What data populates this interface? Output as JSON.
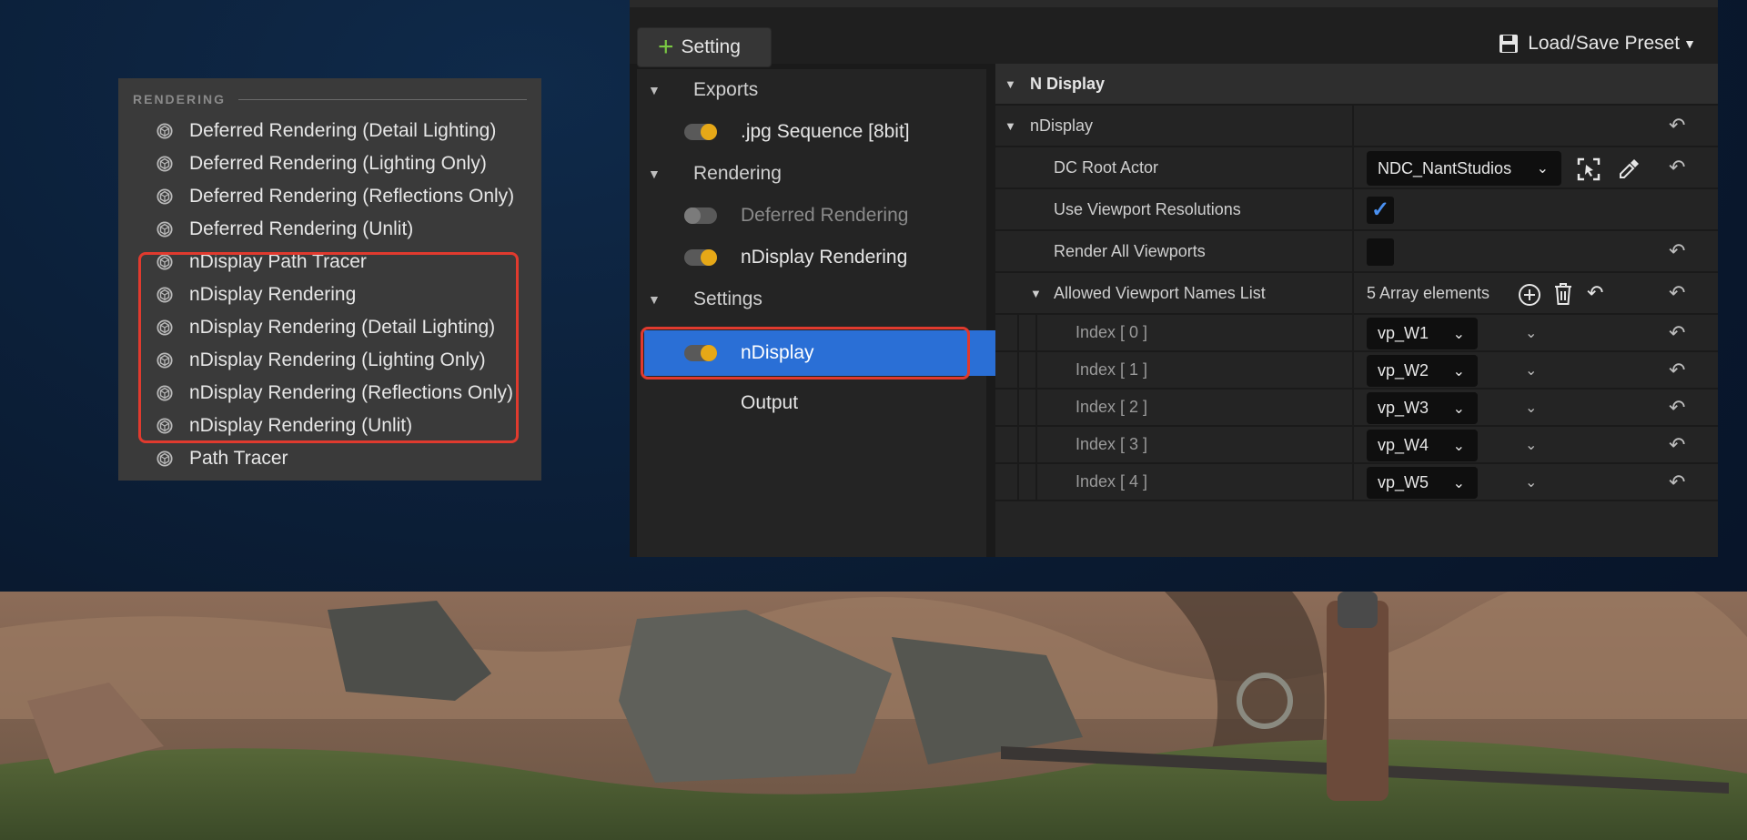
{
  "rendering_list": {
    "section_title": "RENDERING",
    "items": [
      {
        "label": "Deferred Rendering (Detail Lighting)"
      },
      {
        "label": "Deferred Rendering (Lighting Only)"
      },
      {
        "label": "Deferred Rendering (Reflections Only)"
      },
      {
        "label": "Deferred Rendering (Unlit)"
      },
      {
        "label": "nDisplay Path Tracer"
      },
      {
        "label": "nDisplay Rendering"
      },
      {
        "label": "nDisplay Rendering (Detail Lighting)"
      },
      {
        "label": "nDisplay Rendering (Lighting Only)"
      },
      {
        "label": "nDisplay Rendering (Reflections Only)"
      },
      {
        "label": "nDisplay Rendering (Unlit)"
      },
      {
        "label": "Path Tracer"
      }
    ]
  },
  "toolbar": {
    "add_setting_label": "Setting",
    "preset_label": "Load/Save Preset"
  },
  "tree": {
    "exports_label": "Exports",
    "jpg_label": ".jpg Sequence [8bit]",
    "rendering_label": "Rendering",
    "deferred_label": "Deferred Rendering",
    "ndisplay_rendering_label": "nDisplay Rendering",
    "settings_label": "Settings",
    "ndisplay_label": "nDisplay",
    "output_label": "Output"
  },
  "details": {
    "group_title": "N Display",
    "subgroup_title": "nDisplay",
    "root_actor_label": "DC Root Actor",
    "root_actor_value": "NDC_NantStudios",
    "use_viewport_res_label": "Use Viewport Resolutions",
    "use_viewport_res_checked": true,
    "render_all_label": "Render All Viewports",
    "render_all_checked": false,
    "allowed_list_label": "Allowed Viewport Names List",
    "allowed_list_count": "5 Array elements",
    "indices": [
      {
        "label": "Index [ 0 ]",
        "value": "vp_W1"
      },
      {
        "label": "Index [ 1 ]",
        "value": "vp_W2"
      },
      {
        "label": "Index [ 2 ]",
        "value": "vp_W3"
      },
      {
        "label": "Index [ 3 ]",
        "value": "vp_W4"
      },
      {
        "label": "Index [ 4 ]",
        "value": "vp_W5"
      }
    ]
  },
  "colors": {
    "accent_selected": "#2a6fd6",
    "highlight_red": "#e03a2e",
    "toggle_on": "#e6a817",
    "add_green": "#7ac943"
  }
}
